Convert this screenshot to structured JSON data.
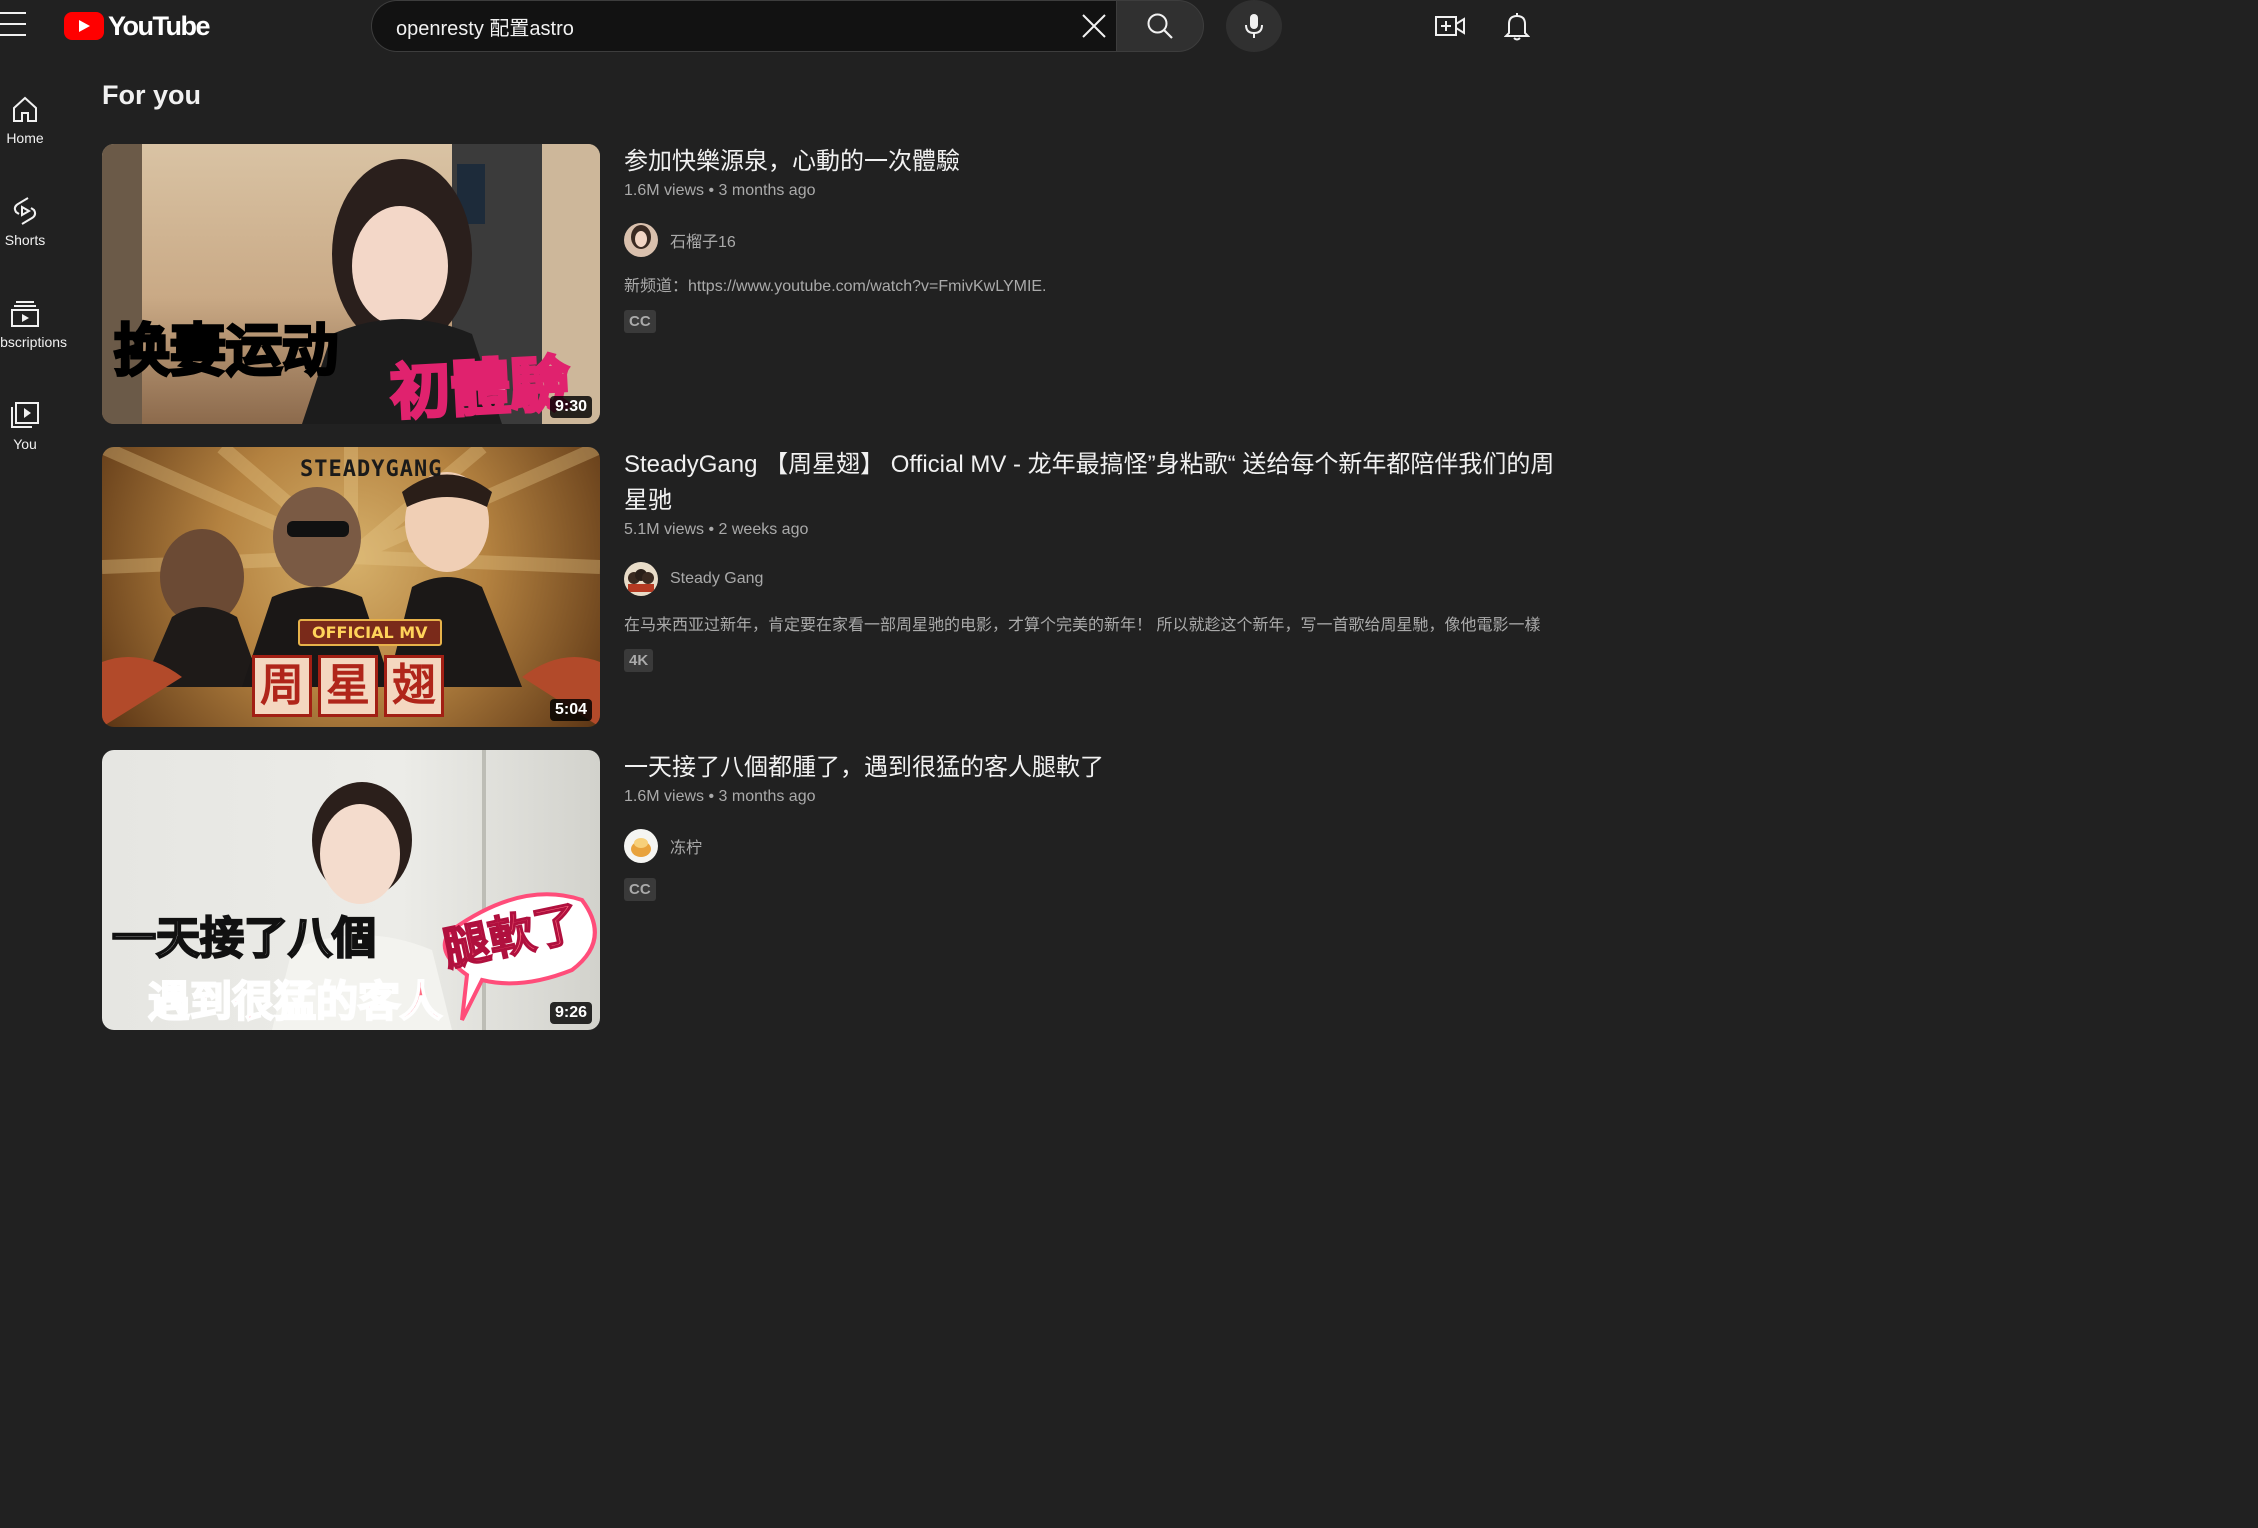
{
  "header": {
    "logo_text": "YouTube",
    "search_value": "openresty 配置astro",
    "icons": {
      "menu": "hamburger-icon",
      "clear": "close-icon",
      "search": "search-icon",
      "mic": "microphone-icon",
      "create": "video-plus-icon",
      "notifications": "bell-icon"
    }
  },
  "sidebar": {
    "items": [
      {
        "label": "Home",
        "icon": "home-icon"
      },
      {
        "label": "Shorts",
        "icon": "shorts-icon"
      },
      {
        "label": "Subscriptions",
        "icon": "subscriptions-icon"
      },
      {
        "label": "You",
        "icon": "you-icon"
      }
    ]
  },
  "main": {
    "section_title": "For you",
    "videos": [
      {
        "title": "参加快樂源泉，心動的一次體驗",
        "views": "1.6M views",
        "age": "3 months ago",
        "channel": "石榴子16",
        "description": "新频道：https://www.youtube.com/watch?v=FmivKwLYMIE.",
        "badge": "CC",
        "duration": "9:30",
        "thumb_caption_1": "换妻运动",
        "thumb_caption_2": "初體驗"
      },
      {
        "title": "SteadyGang 【周星翅】 Official MV - 龙年最搞怪”身粘歌“ 送给每个新年都陪伴我们的周星驰",
        "views": "5.1M views",
        "age": "2 weeks ago",
        "channel": "Steady Gang",
        "description": "在马来西亚过新年，肯定要在家看一部周星驰的电影，才算个完美的新年！ 所以就趁这个新年，写一首歌给周星馳，像他電影一樣",
        "badge": "4K",
        "duration": "5:04",
        "thumb_caption_1": "STEADYGANG",
        "thumb_caption_2": "OFFICIAL MV",
        "thumb_caption_3": [
          "周",
          "星",
          "翅"
        ]
      },
      {
        "title": "一天接了八個都腫了，遇到很猛的客人腿軟了",
        "views": "1.6M views",
        "age": "3 months ago",
        "channel": "冻柠",
        "description": "",
        "badge": "CC",
        "duration": "9:26",
        "thumb_caption_1": "一天接了八個",
        "thumb_caption_2": "遇到很猛的客人",
        "thumb_caption_3": "腿軟了"
      }
    ]
  },
  "colors": {
    "background": "#212121",
    "brand_red": "#ff0000",
    "text_primary": "#f1f1f1",
    "text_secondary": "#aaaaaa",
    "badge_bg": "#3a3a3a"
  }
}
